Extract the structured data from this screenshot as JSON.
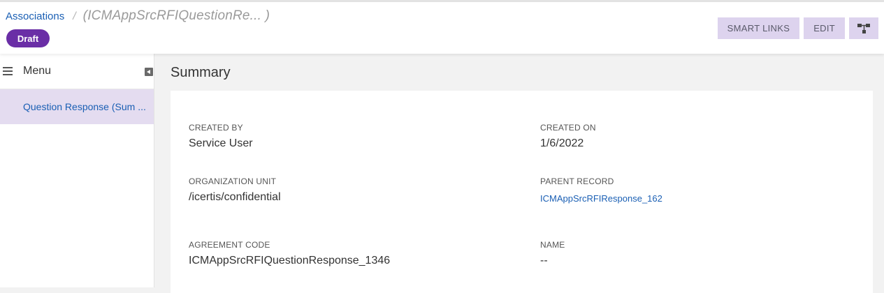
{
  "breadcrumb": {
    "link": "Associations",
    "separator": "/",
    "current": "(ICMAppSrcRFIQuestionRe... )"
  },
  "status_badge": "Draft",
  "actions": {
    "smart_links": "SMART LINKS",
    "edit": "EDIT",
    "hierarchy_icon": "hierarchy-icon"
  },
  "sidebar": {
    "menu_label": "Menu",
    "items": [
      {
        "label": "Question Response (Sum ..."
      }
    ]
  },
  "main": {
    "title": "Summary",
    "fields": {
      "created_by": {
        "label": "CREATED BY",
        "value": "Service User"
      },
      "created_on": {
        "label": "CREATED ON",
        "value": "1/6/2022"
      },
      "organization_unit": {
        "label": "ORGANIZATION UNIT",
        "value": "/icertis/confidential"
      },
      "parent_record": {
        "label": "PARENT RECORD",
        "value": "ICMAppSrcRFIResponse_162"
      },
      "agreement_code": {
        "label": "AGREEMENT CODE",
        "value": "ICMAppSrcRFIQuestionResponse_1346"
      },
      "name": {
        "label": "NAME",
        "value": "--"
      }
    }
  },
  "colors": {
    "accent": "#6a2ea6",
    "button_bg": "#ddd3ee",
    "link": "#1a5fb4",
    "selected_menu_bg": "#e4dcf0"
  }
}
